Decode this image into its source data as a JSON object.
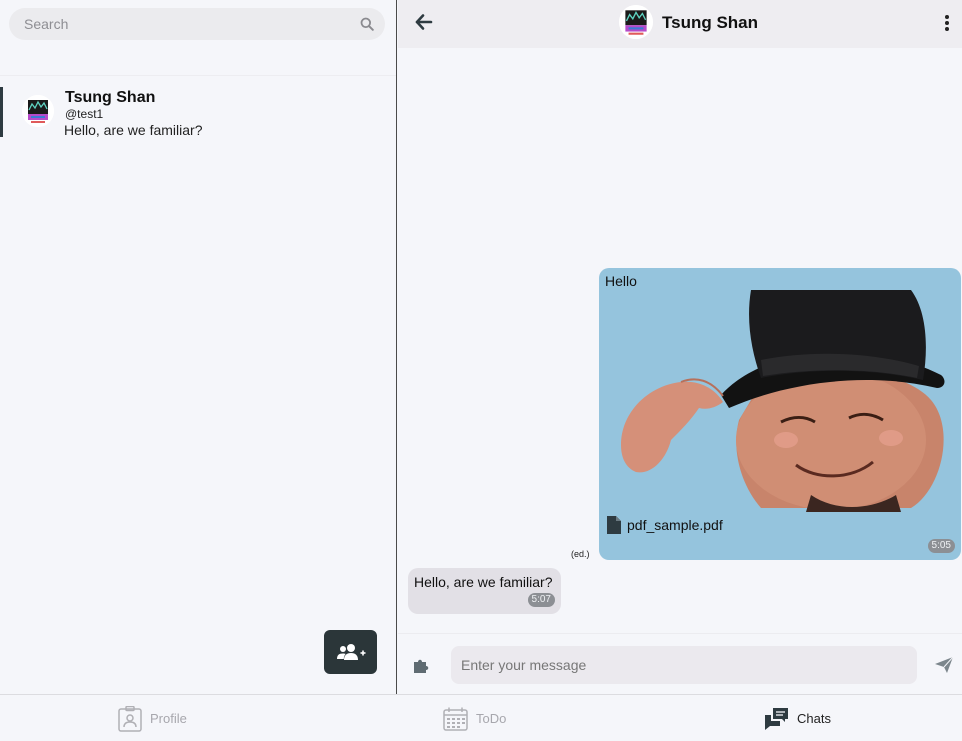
{
  "search": {
    "placeholder": "Search"
  },
  "chat_list": [
    {
      "name": "Tsung Shan",
      "handle": "@test1",
      "preview": "Hello, are we familiar?"
    }
  ],
  "chat": {
    "contact_name": "Tsung Shan",
    "messages": [
      {
        "direction": "outgoing",
        "text": "Hello",
        "attachment": "pdf_sample.pdf",
        "time": "5:05",
        "edited": "(ed.)"
      },
      {
        "direction": "incoming",
        "text": "Hello, are we familiar?",
        "time": "5:07"
      }
    ],
    "composer_placeholder": "Enter your message"
  },
  "nav": [
    {
      "label": "Profile",
      "icon": "profile-card-icon",
      "active": false
    },
    {
      "label": "ToDo",
      "icon": "calendar-icon",
      "active": false
    },
    {
      "label": "Chats",
      "icon": "chat-bubbles-icon",
      "active": true
    }
  ],
  "colors": {
    "outgoing_bubble": "#95c4dd",
    "incoming_bubble": "#e2e0e6",
    "fab": "#2b3639",
    "header_bg": "#eeedf1"
  }
}
